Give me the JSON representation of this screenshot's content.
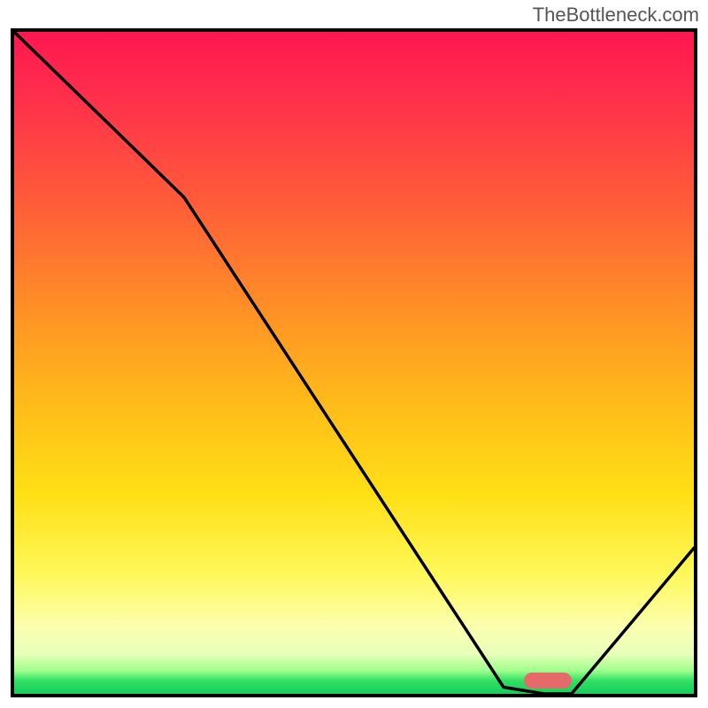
{
  "watermark": "TheBottleneck.com",
  "chart_data": {
    "type": "line",
    "title": "",
    "xlabel": "",
    "ylabel": "",
    "xlim": [
      0,
      100
    ],
    "ylim": [
      0,
      100
    ],
    "series": [
      {
        "name": "bottleneck-curve",
        "x": [
          0,
          25,
          72,
          78,
          82,
          100
        ],
        "values": [
          100,
          75,
          1,
          0,
          0,
          22
        ]
      }
    ],
    "annotations": [
      {
        "name": "optimal-marker",
        "x_start": 75,
        "x_end": 82,
        "y": 0
      }
    ],
    "background_gradient": {
      "stops": [
        {
          "pos": 0.0,
          "color": "#ff1750"
        },
        {
          "pos": 0.4,
          "color": "#ff8a28"
        },
        {
          "pos": 0.7,
          "color": "#ffe016"
        },
        {
          "pos": 0.9,
          "color": "#fbffb0"
        },
        {
          "pos": 0.98,
          "color": "#32e064"
        },
        {
          "pos": 1.0,
          "color": "#19cc5c"
        }
      ]
    }
  }
}
